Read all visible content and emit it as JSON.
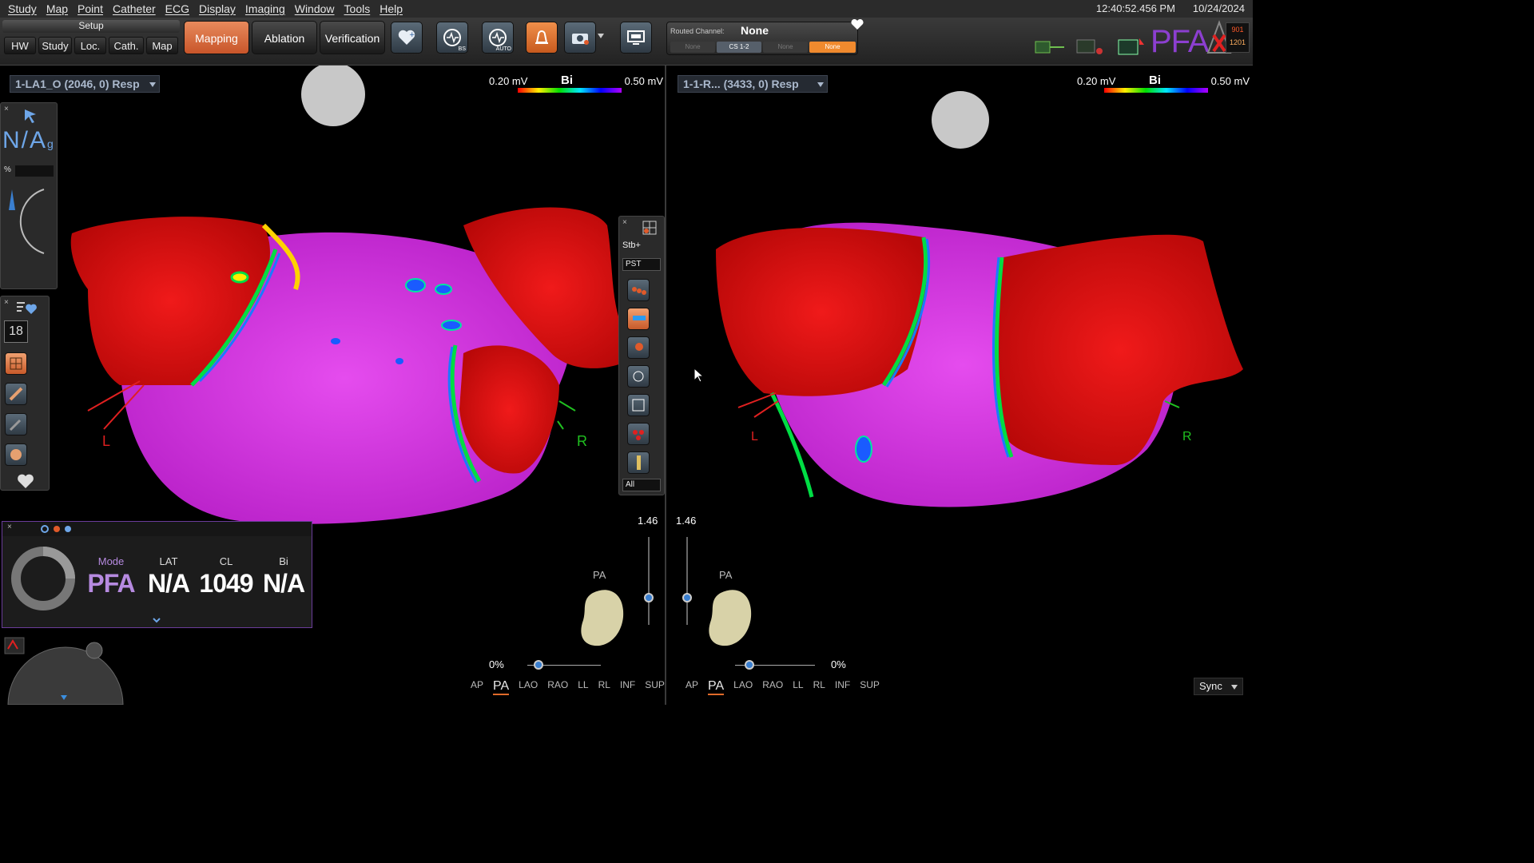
{
  "menu": [
    "Study",
    "Map",
    "Point",
    "Catheter",
    "ECG",
    "Display",
    "Imaging",
    "Window",
    "Tools",
    "Help"
  ],
  "datetime": {
    "time": "12:40:52.456 PM",
    "date": "10/24/2024"
  },
  "toolbar": {
    "setup_label": "Setup",
    "setup_buttons": [
      "HW",
      "Study",
      "Loc.",
      "Cath.",
      "Map"
    ],
    "workflow": [
      "Mapping",
      "Ablation",
      "Verification"
    ],
    "active_workflow": "Mapping",
    "tool_icons": [
      {
        "name": "heart-add-icon",
        "sub": ""
      },
      {
        "name": "compass-bs-icon",
        "sub": "BS"
      },
      {
        "name": "compass-auto-icon",
        "sub": "AUTO"
      },
      {
        "name": "bell-alert-icon",
        "sub": ""
      },
      {
        "name": "camera-icon",
        "sub": ""
      },
      {
        "name": "monitor-icon",
        "sub": ""
      }
    ],
    "routed_channel": {
      "title": "Routed Channel:",
      "value": "None",
      "chips": [
        "None",
        "CS 1-2",
        "None",
        "None"
      ]
    },
    "status": {
      "counter_top": "901",
      "counter_bottom": "1201",
      "logo": "PFA"
    }
  },
  "left_view": {
    "map_name": "1-LA1_O (2046, 0) Resp",
    "scale": {
      "min": "0.20 mV",
      "type": "Bi",
      "max": "0.50 mV"
    },
    "labels": {
      "left": "L",
      "right": "R"
    },
    "zoom": "1.46",
    "orientation": "PA",
    "percent": "0%",
    "views": [
      "AP",
      "PA",
      "LAO",
      "RAO",
      "LL",
      "RL",
      "INF",
      "SUP"
    ],
    "active_view": "PA"
  },
  "right_view": {
    "map_name": "1-1-R... (3433, 0) Resp",
    "scale": {
      "min": "0.20 mV",
      "type": "Bi",
      "max": "0.50 mV"
    },
    "labels": {
      "left": "L",
      "right": "R"
    },
    "zoom": "1.46",
    "orientation": "PA",
    "percent": "0%",
    "views": [
      "AP",
      "PA",
      "LAO",
      "RAO",
      "LL",
      "RL",
      "INF",
      "SUP"
    ],
    "active_view": "PA"
  },
  "side_palette": {
    "catheter_value": "N/A",
    "catheter_sub": "g",
    "percent_label": "%",
    "count": "18"
  },
  "point_palette": {
    "stb_label": "Stb+",
    "filter": "PST",
    "all_select": "All"
  },
  "info_panel": {
    "columns": [
      {
        "label": "Mode",
        "value": "PFA"
      },
      {
        "label": "LAT",
        "value": "N/A"
      },
      {
        "label": "CL",
        "value": "1049"
      },
      {
        "label": "Bi",
        "value": "N/A"
      }
    ]
  },
  "sync": "Sync",
  "colors": {
    "accent": "#e06a2a",
    "purple": "#b68ae0",
    "map_low": "#ff0000",
    "map_high": "#d020e0"
  }
}
